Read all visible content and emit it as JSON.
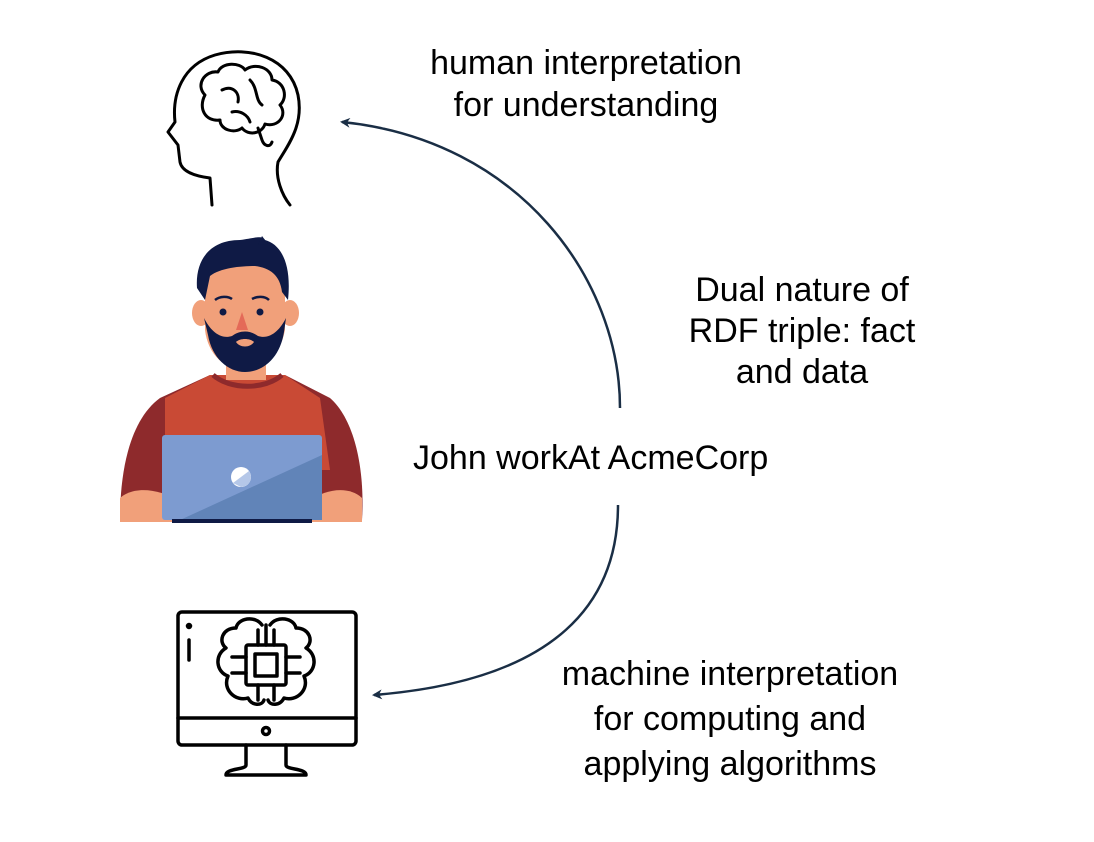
{
  "human_label": [
    "human interpretation",
    "for understanding"
  ],
  "dual_label": [
    "Dual nature of",
    "RDF triple: fact",
    "and data"
  ],
  "triple_label": "John workAt AcmeCorp",
  "machine_label": [
    "machine interpretation",
    "for computing and",
    "applying algorithms"
  ],
  "icons": [
    "brain-head-icon",
    "person-with-laptop-illustration",
    "computer-ai-chip-icon"
  ],
  "colors": {
    "arrow": "#1a2e45",
    "shirt": "#c94a35",
    "laptop": "#6f90c4",
    "hair": "#0f1a45",
    "skin": "#f1a07a"
  }
}
